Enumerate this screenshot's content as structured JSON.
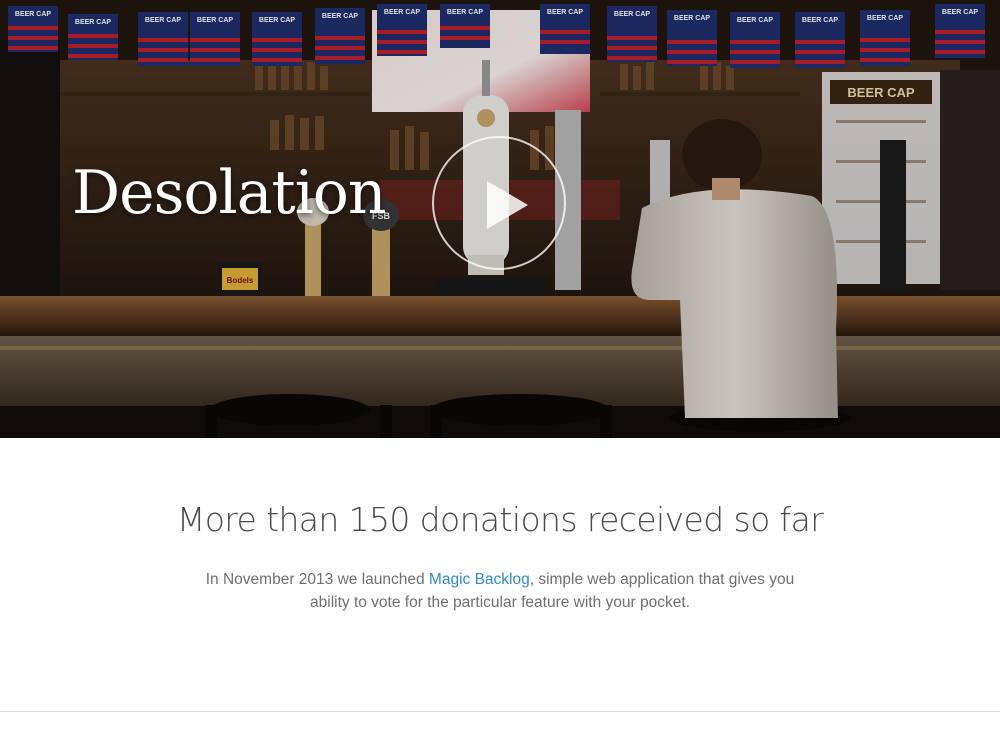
{
  "hero": {
    "title": "Desolation",
    "sign_text": "BEER CAP",
    "fridge_sign": "BEER CAP",
    "badge_text": "FSB",
    "tap_label": "Bodels",
    "play_icon": "play-icon",
    "colors": {
      "overlay": "#2c1d15",
      "flag_blue": "#1f2f6e",
      "flag_red": "#c0202d"
    }
  },
  "content": {
    "headline": "More than 150 donations received so far",
    "desc_before": "In November 2013 we launched ",
    "desc_link": "Magic Backlog",
    "desc_after": ", simple web application that gives you ability to vote for the particular feature with your pocket.",
    "link_color": "#2f8bd0"
  }
}
